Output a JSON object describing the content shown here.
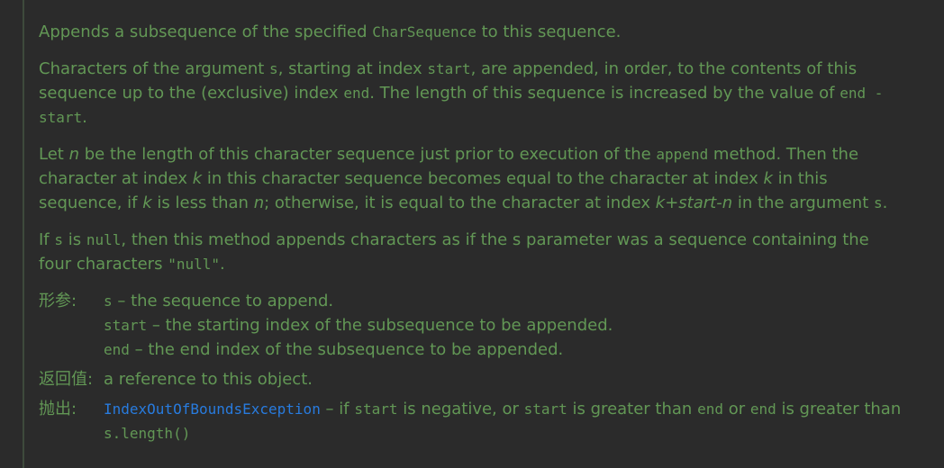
{
  "doc": {
    "summary": {
      "pre": "Appends a subsequence of the specified ",
      "code": "CharSequence",
      "post": " to this sequence."
    },
    "p1": {
      "t1": "Characters of the argument ",
      "c1": "s",
      "t2": ", starting at index ",
      "c2": "start",
      "t3": ", are appended, in order, to the contents of this sequence up to the (exclusive) index ",
      "c3": "end",
      "t4": ". The length of this sequence is increased by the value of ",
      "c4": "end - start",
      "t5": "."
    },
    "p2": {
      "t1": "Let ",
      "e1": "n",
      "t2": " be the length of this character sequence just prior to execution of the ",
      "c1": "append",
      "t3": " method. Then the character at index ",
      "e2": "k",
      "t4": " in this character sequence becomes equal to the character at index ",
      "e3": "k",
      "t5": " in this sequence, if ",
      "e4": "k",
      "t6": " is less than ",
      "e5": "n",
      "t7": "; otherwise, it is equal to the character at index ",
      "e6": "k+start-n",
      "t8": " in the argument ",
      "c2": "s",
      "t9": "."
    },
    "p3": {
      "t1": "If ",
      "c1": "s",
      "t2": " is ",
      "c2": "null",
      "t3": ", then this method appends characters as if the s parameter was a sequence containing the four characters ",
      "c3": "\"null\"",
      "t4": "."
    },
    "params": {
      "label": "形参:",
      "items": [
        {
          "name": "s",
          "desc": " – the sequence to append."
        },
        {
          "name": "start",
          "desc": " – the starting index of the subsequence to be appended."
        },
        {
          "name": "end",
          "desc": " – the end index of the subsequence to be appended."
        }
      ]
    },
    "returns": {
      "label": "返回值:",
      "text": "a reference to this object."
    },
    "throws": {
      "label": "抛出:",
      "exception": "IndexOutOfBoundsException",
      "t1": " – if ",
      "c1": "start",
      "t2": " is negative, or ",
      "c2": "start",
      "t3": " is greater than ",
      "c3": "end",
      "t4": " or ",
      "c4": "end",
      "t5": " is greater than ",
      "c5": "s.length()"
    }
  },
  "colors": {
    "background": "#2b2b2b",
    "text": "#629755",
    "link": "#287bde"
  }
}
